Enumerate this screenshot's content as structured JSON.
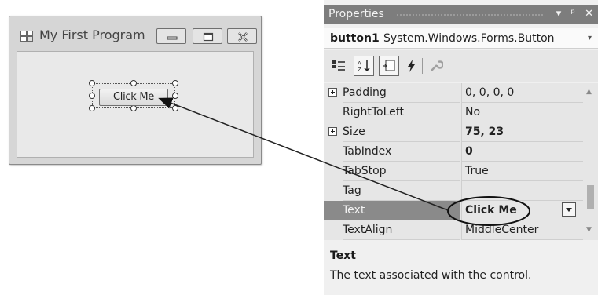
{
  "form": {
    "title": "My First Program",
    "button_text": "Click Me"
  },
  "properties": {
    "header_title": "Properties",
    "header_controls": [
      "▾",
      "ᵖ",
      "✕"
    ],
    "object_name": "button1",
    "object_type": "System.Windows.Forms.Button",
    "rows": [
      {
        "name": "Padding",
        "value": "0, 0, 0, 0",
        "expandable": true,
        "bold": false
      },
      {
        "name": "RightToLeft",
        "value": "No",
        "expandable": false,
        "bold": false
      },
      {
        "name": "Size",
        "value": "75, 23",
        "expandable": true,
        "bold": true
      },
      {
        "name": "TabIndex",
        "value": "0",
        "expandable": false,
        "bold": true
      },
      {
        "name": "TabStop",
        "value": "True",
        "expandable": false,
        "bold": false
      },
      {
        "name": "Tag",
        "value": "",
        "expandable": false,
        "bold": false
      },
      {
        "name": "Text",
        "value": "Click Me",
        "expandable": false,
        "bold": true,
        "selected": true
      },
      {
        "name": "TextAlign",
        "value": "MiddleCenter",
        "expandable": false,
        "bold": false
      }
    ],
    "description_title": "Text",
    "description_text": "The text associated with the control."
  }
}
